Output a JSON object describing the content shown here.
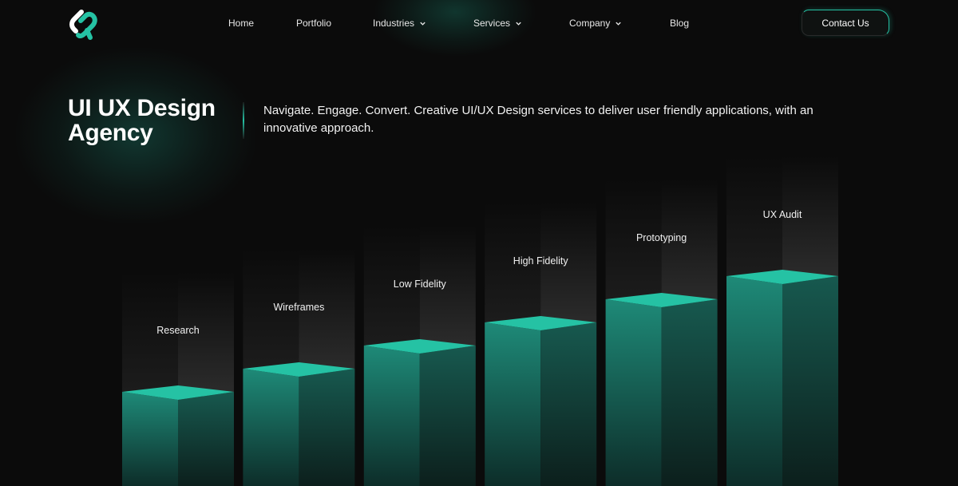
{
  "nav": {
    "items": [
      {
        "label": "Home",
        "dropdown": false
      },
      {
        "label": "Portfolio",
        "dropdown": false
      },
      {
        "label": "Industries",
        "dropdown": true
      },
      {
        "label": "Services",
        "dropdown": true
      },
      {
        "label": "Company",
        "dropdown": true
      },
      {
        "label": "Blog",
        "dropdown": false
      }
    ],
    "contact_label": "Contact Us"
  },
  "logo": {
    "icon": "brand-logo-icon"
  },
  "hero": {
    "title": "UI UX Design Agency",
    "description": "Navigate. Engage. Convert. Creative UI/UX Design services to deliver user friendly applications, with an innovative approach."
  },
  "steps": [
    {
      "label": "Research",
      "level": 1
    },
    {
      "label": "Wireframes",
      "level": 2
    },
    {
      "label": "Low Fidelity",
      "level": 3
    },
    {
      "label": "High Fidelity",
      "level": 4
    },
    {
      "label": "Prototyping",
      "level": 5
    },
    {
      "label": "UX Audit",
      "level": 6
    }
  ],
  "colors": {
    "accent": "#25c2a4",
    "background": "#0b0b0b",
    "bar_front": "#1f8f7c",
    "bar_side": "#155f54"
  }
}
